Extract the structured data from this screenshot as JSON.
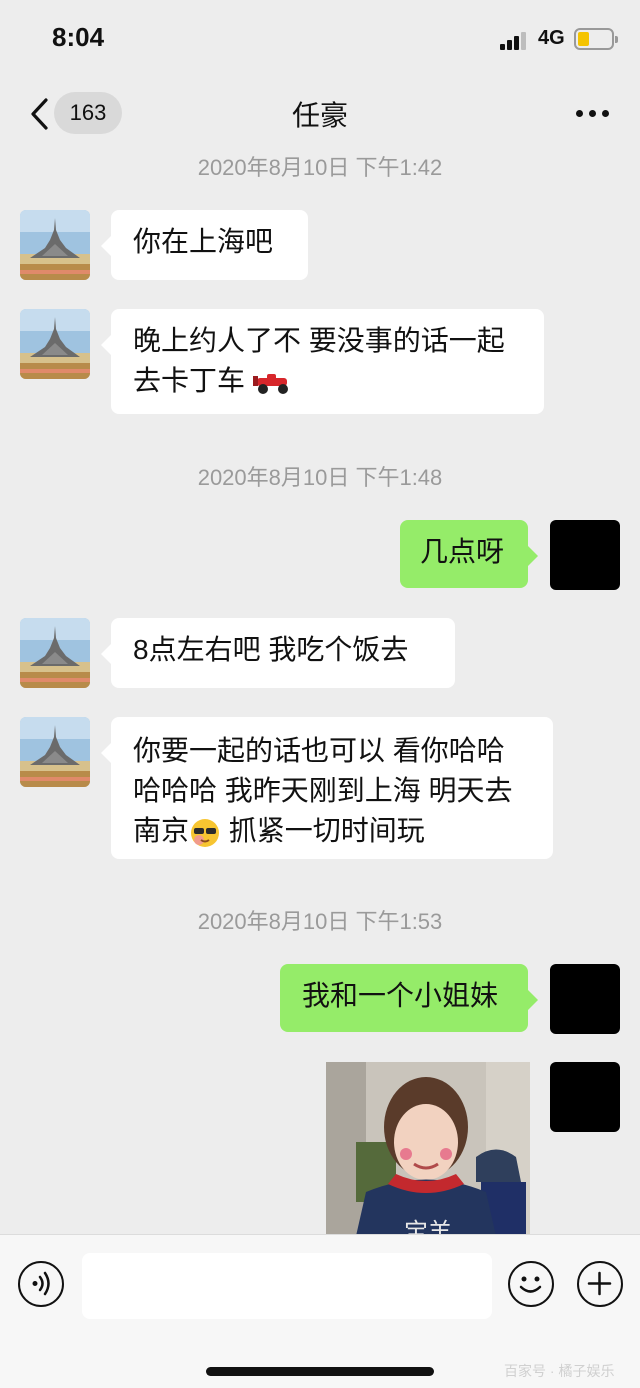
{
  "status_bar": {
    "time": "8:04",
    "network": "4G",
    "battery_level": 0.3
  },
  "nav": {
    "back_badge": "163",
    "title": "任豪"
  },
  "timestamps": [
    "2020年8月10日 下午1:42",
    "2020年8月10日 下午1:48",
    "2020年8月10日 下午1:53"
  ],
  "messages": [
    {
      "from": "contact",
      "text": "你在上海吧"
    },
    {
      "from": "contact",
      "line1": "晚上约人了不 要没事的话一起",
      "line2": "去卡丁车",
      "emoji": "race-car"
    },
    {
      "from": "me",
      "text": "几点呀"
    },
    {
      "from": "contact",
      "text": "8点左右吧 我吃个饭去"
    },
    {
      "from": "contact",
      "line1": "你要一起的话也可以 看你哈哈",
      "line2": "哈哈哈 我昨天刚到上海 明天去",
      "line3a": "南京",
      "line3b": " 抓紧一切时间玩",
      "emoji": "sunglasses-face"
    },
    {
      "from": "me",
      "text": "我和一个小姐妹"
    },
    {
      "from": "me",
      "type": "image",
      "photo_text": "宝羊"
    }
  ],
  "input_bar": {
    "voice_icon": "voice-icon",
    "emoji_icon": "emoji-icon",
    "plus_icon": "plus-icon"
  },
  "watermark": "百家号 · 橘子娱乐",
  "colors": {
    "background": "#ededed",
    "outgoing_bubble": "#95ec69",
    "incoming_bubble": "#ffffff",
    "timestamp": "#9a9a9a"
  }
}
